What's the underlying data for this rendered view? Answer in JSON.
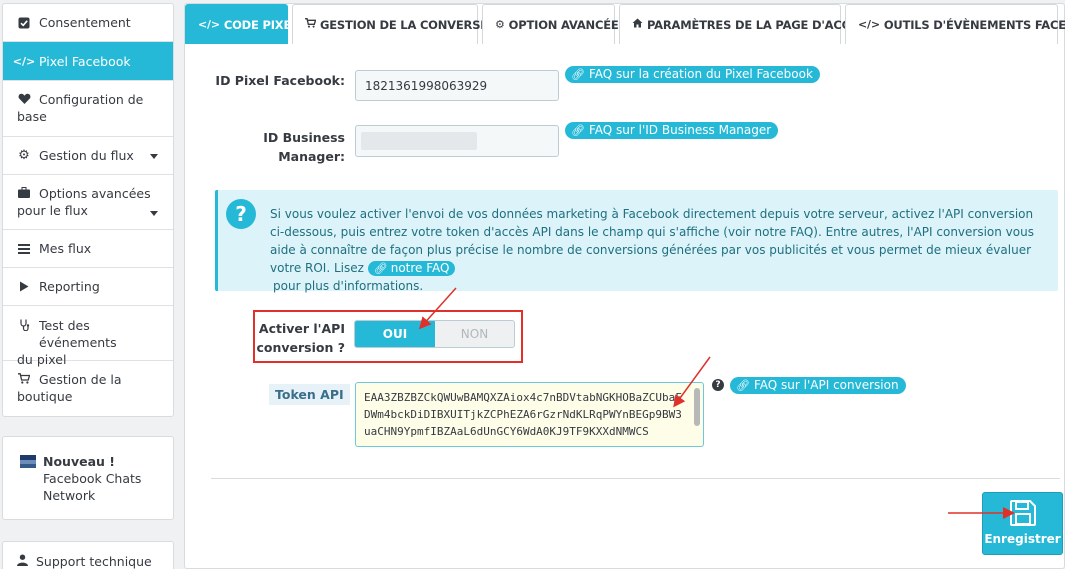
{
  "sidebar": {
    "items": [
      {
        "label": "Consentement",
        "icon": "check-square-icon"
      },
      {
        "label": "Pixel Facebook",
        "icon": "code-icon"
      },
      {
        "label": "Configuration de base",
        "label_l1": "Configuration de",
        "label_l2": "base",
        "icon": "heart-icon"
      },
      {
        "label": "Gestion du flux",
        "icon": "gear-icon"
      },
      {
        "label": "Options avancées pour le flux",
        "label_l1": "Options avancées",
        "label_l2": "pour le flux",
        "icon": "briefcase-icon"
      },
      {
        "label": "Mes flux",
        "icon": "list-icon"
      },
      {
        "label": "Reporting",
        "icon": "play-icon"
      },
      {
        "label": "Test des événements du pixel",
        "label_l1": "Test des événements",
        "label_l2": "du pixel",
        "icon": "stethoscope-icon"
      },
      {
        "label": "Gestion de la boutique",
        "label_l1": "Gestion de la",
        "label_l2": "boutique",
        "icon": "cart-icon"
      }
    ],
    "news": {
      "title": "Nouveau !",
      "line2": "Facebook Chats",
      "line3": "Network"
    },
    "support": "Support technique"
  },
  "tabs": [
    {
      "label": "CODE PIXEL",
      "icon": "code-icon"
    },
    {
      "label": "GESTION DE LA CONVERSION",
      "icon": "cart-icon"
    },
    {
      "label": "OPTION AVANCÉE",
      "icon": "gears-icon"
    },
    {
      "label": "PARAMÈTRES DE LA PAGE D'ACCUEIL",
      "icon": "home-icon"
    },
    {
      "label": "OUTILS D'ÉVÈNEMENTS FACEBOOK",
      "icon": "code-icon"
    }
  ],
  "form": {
    "pixel_label": "ID Pixel Facebook:",
    "pixel_value": "1821361998063929",
    "pixel_faq": "FAQ sur la création du Pixel Facebook",
    "bm_label_l1": "ID Business",
    "bm_label_l2": "Manager:",
    "bm_value": "",
    "bm_faq": "FAQ sur l'ID Business Manager",
    "alert_text": "Si vous voulez activer l'envoi de vos données marketing à Facebook directement depuis votre serveur, activez l'API conversion ci-dessous, puis entrez votre token d'accès API dans le champ qui s'affiche (voir notre FAQ). Entre autres, l'API conversion vous aide à connaître de façon plus précise le nombre de conversions générées par vos publicités et vous permet de mieux évaluer votre ROI. Lisez",
    "alert_faq": "notre FAQ",
    "alert_end": "pour plus d'informations.",
    "api_label_l1": "Activer l'API",
    "api_label_l2": "conversion ?",
    "switch_on": "OUI",
    "switch_off": "NON",
    "token_label": "Token API",
    "token_value": "EAA3ZBZBZCkQWUwBAMQXZAiox4c7nBDVtabNGKHOBaZCUbaFDWm4bckDiDIBXUITjkZCPhEZA6rGzrNdKLRqPWYnBEGp9BW3uaCHN9YpmfIBZAaL6dUnGCY6WdA0KJ9TF9KXXdNMWCS",
    "token_faq": "FAQ sur l'API conversion",
    "save": "Enregistrer"
  },
  "colors": {
    "accent": "#25b9d7",
    "highlight": "#e0302a"
  }
}
